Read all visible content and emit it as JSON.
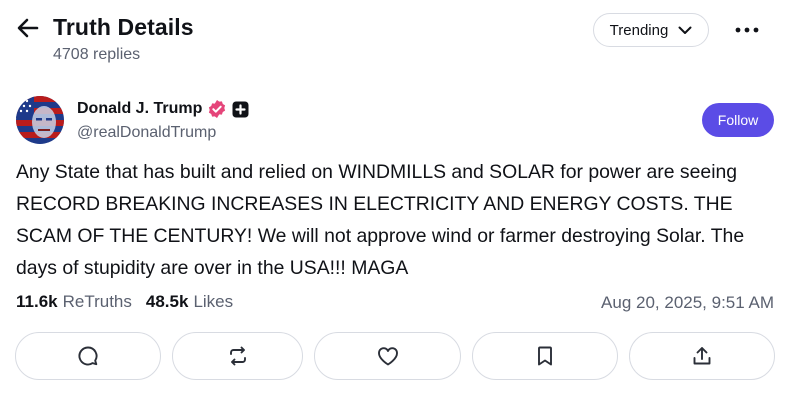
{
  "header": {
    "title": "Truth Details",
    "replies_count": "4708 replies",
    "sort_label": "Trending"
  },
  "post": {
    "author": {
      "display_name": "Donald J. Trump",
      "handle": "@realDonaldTrump"
    },
    "follow_label": "Follow",
    "text": "Any State that has built and relied on WINDMILLS and SOLAR for power are seeing RECORD BREAKING INCREASES IN ELECTRICITY AND ENERGY COSTS. THE SCAM OF THE CENTURY! We will not approve wind or farmer destroying Solar. The days of stupidity are over in the USA!!! MAGA",
    "retruths_count": "11.6k",
    "retruths_label": "ReTruths",
    "likes_count": "48.5k",
    "likes_label": "Likes",
    "timestamp": "Aug 20, 2025, 9:51 AM"
  },
  "actions": [
    {
      "name": "reply",
      "icon": "comment-icon"
    },
    {
      "name": "retruth",
      "icon": "repost-icon"
    },
    {
      "name": "like",
      "icon": "heart-icon"
    },
    {
      "name": "bookmark",
      "icon": "bookmark-icon"
    },
    {
      "name": "share",
      "icon": "share-icon"
    }
  ],
  "colors": {
    "accent": "#5b4ce6",
    "verified_badge": "#e5457a",
    "text_primary": "#101217",
    "text_secondary": "#5b6170",
    "border": "#d8dbe2"
  }
}
